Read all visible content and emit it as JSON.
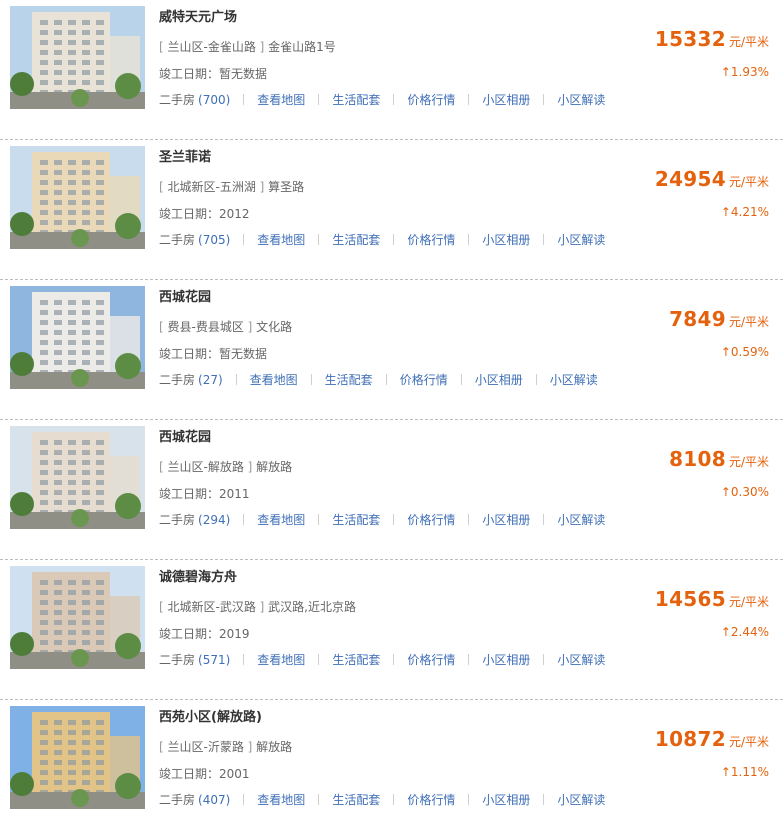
{
  "accent_color": "#e4620d",
  "link_color": "#3f6fb7",
  "items": [
    {
      "name": "威特天元广场",
      "district": "兰山区-金雀山路",
      "street": "金雀山路1号",
      "date_label": "竣工日期：",
      "date_value": "暂无数据",
      "price": "15332",
      "unit": "元/平米",
      "change": "1.93%",
      "trend": "up",
      "links": {
        "secondhand_label": "二手房",
        "secondhand_count": "(700)",
        "map": "查看地图",
        "life": "生活配套",
        "market": "价格行情",
        "album": "小区相册",
        "analysis": "小区解读"
      }
    },
    {
      "name": "圣兰菲诺",
      "district": "北城新区-五洲湖",
      "street": "算圣路",
      "date_label": "竣工日期：",
      "date_value": "2012",
      "price": "24954",
      "unit": "元/平米",
      "change": "4.21%",
      "trend": "up",
      "links": {
        "secondhand_label": "二手房",
        "secondhand_count": "(705)",
        "map": "查看地图",
        "life": "生活配套",
        "market": "价格行情",
        "album": "小区相册",
        "analysis": "小区解读"
      }
    },
    {
      "name": "西城花园",
      "district": "费县-费县城区",
      "street": "文化路",
      "date_label": "竣工日期：",
      "date_value": "暂无数据",
      "price": "7849",
      "unit": "元/平米",
      "change": "0.59%",
      "trend": "up",
      "links": {
        "secondhand_label": "二手房",
        "secondhand_count": "(27)",
        "map": "查看地图",
        "life": "生活配套",
        "market": "价格行情",
        "album": "小区相册",
        "analysis": "小区解读"
      }
    },
    {
      "name": "西城花园",
      "district": "兰山区-解放路",
      "street": "解放路",
      "date_label": "竣工日期：",
      "date_value": "2011",
      "price": "8108",
      "unit": "元/平米",
      "change": "0.30%",
      "trend": "up",
      "links": {
        "secondhand_label": "二手房",
        "secondhand_count": "(294)",
        "map": "查看地图",
        "life": "生活配套",
        "market": "价格行情",
        "album": "小区相册",
        "analysis": "小区解读"
      }
    },
    {
      "name": "诚德碧海方舟",
      "district": "北城新区-武汉路",
      "street": "武汉路,近北京路",
      "date_label": "竣工日期：",
      "date_value": "2019",
      "price": "14565",
      "unit": "元/平米",
      "change": "2.44%",
      "trend": "up",
      "links": {
        "secondhand_label": "二手房",
        "secondhand_count": "(571)",
        "map": "查看地图",
        "life": "生活配套",
        "market": "价格行情",
        "album": "小区相册",
        "analysis": "小区解读"
      }
    },
    {
      "name": "西苑小区(解放路)",
      "district": "兰山区-沂蒙路",
      "street": "解放路",
      "date_label": "竣工日期：",
      "date_value": "2001",
      "price": "10872",
      "unit": "元/平米",
      "change": "1.11%",
      "trend": "up",
      "links": {
        "secondhand_label": "二手房",
        "secondhand_count": "(407)",
        "map": "查看地图",
        "life": "生活配套",
        "market": "价格行情",
        "album": "小区相册",
        "analysis": "小区解读"
      }
    }
  ]
}
